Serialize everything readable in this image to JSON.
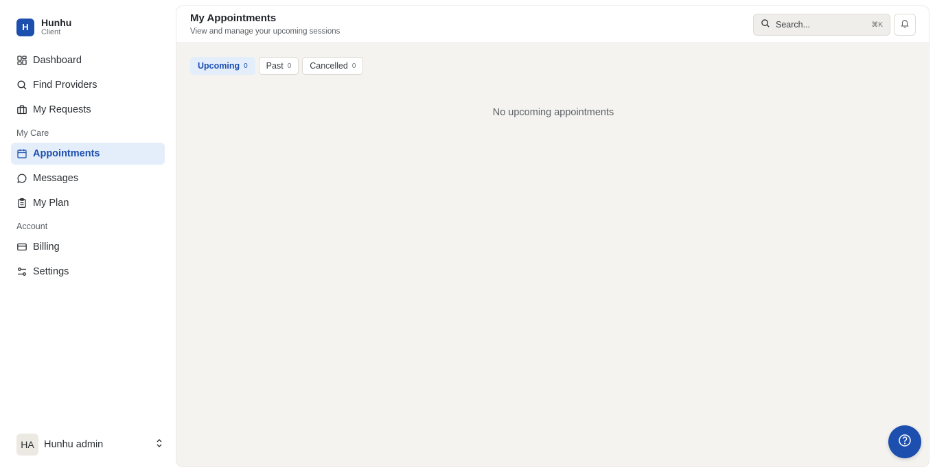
{
  "brand": {
    "logo_letter": "H",
    "name": "Hunhu",
    "role": "Client"
  },
  "nav": {
    "items": [
      {
        "label": "Dashboard",
        "icon": "dashboard-icon"
      },
      {
        "label": "Find Providers",
        "icon": "search-icon"
      },
      {
        "label": "My Requests",
        "icon": "briefcase-icon"
      }
    ],
    "sections": [
      {
        "title": "My Care",
        "items": [
          {
            "label": "Appointments",
            "icon": "calendar-icon",
            "active": true
          },
          {
            "label": "Messages",
            "icon": "message-icon"
          },
          {
            "label": "My Plan",
            "icon": "clipboard-icon"
          }
        ]
      },
      {
        "title": "Account",
        "items": [
          {
            "label": "Billing",
            "icon": "credit-card-icon"
          },
          {
            "label": "Settings",
            "icon": "settings-sliders-icon"
          }
        ]
      }
    ]
  },
  "user": {
    "initials": "HA",
    "name": "Hunhu admin"
  },
  "header": {
    "title": "My Appointments",
    "subtitle": "View and manage your upcoming sessions",
    "search_placeholder": "Search...",
    "search_shortcut": "⌘K"
  },
  "tabs": [
    {
      "label": "Upcoming",
      "count": "0",
      "active": true
    },
    {
      "label": "Past",
      "count": "0"
    },
    {
      "label": "Cancelled",
      "count": "0"
    }
  ],
  "empty_state": "No upcoming appointments",
  "colors": {
    "accent": "#1d4fae",
    "active_bg": "#e4eefb",
    "content_bg": "#f4f3f0"
  }
}
